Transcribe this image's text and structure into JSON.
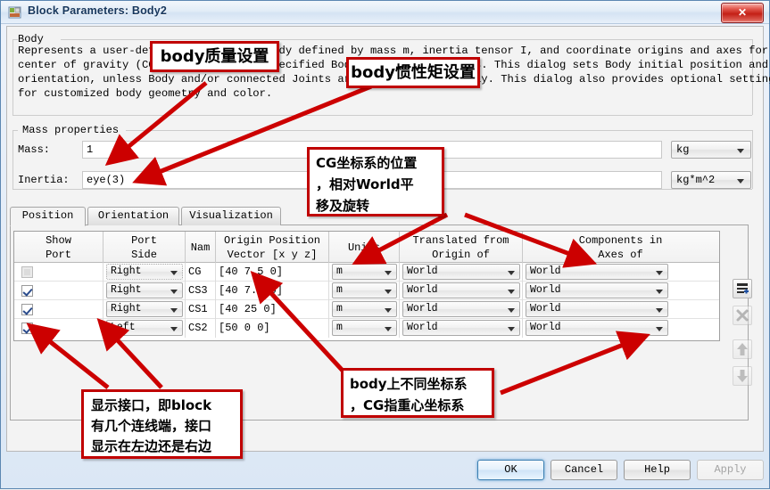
{
  "window": {
    "title": "Block Parameters: Body2",
    "icon": "block-parameters-icon",
    "close_label": "✕"
  },
  "description": {
    "heading": "Body",
    "lines": [
      "Represents a user-defined rigid body. Body defined by mass m, inertia tensor I, and coordinate origins and axes for",
      "center of gravity (CG) and other user-specified Body coordinate systems. This dialog sets Body initial position and",
      "orientation, unless Body and/or connected Joints are actuated separately. This dialog also provides optional settings",
      "for customized body geometry and color."
    ]
  },
  "mass_properties": {
    "group_title": "Mass properties",
    "mass": {
      "label": "Mass:",
      "value": "1",
      "unit": "kg"
    },
    "inertia": {
      "label": "Inertia:",
      "value": "eye(3)",
      "unit": "kg*m^2"
    }
  },
  "tabs": [
    {
      "label": "Position",
      "active": true
    },
    {
      "label": "Orientation",
      "active": false
    },
    {
      "label": "Visualization",
      "active": false
    }
  ],
  "table": {
    "headers": [
      "Show\nPort",
      "Port\nSide",
      "Nam",
      "Origin Position\nVector [x y z]",
      "Units",
      "Translated from\nOrigin of",
      "Components in\nAxes of"
    ],
    "rows": [
      {
        "show_port": false,
        "show_port_enabled": false,
        "port_side": "Right",
        "name": "CG",
        "origin_position": "[40 7.5 0]",
        "units": "m",
        "translated_from": "World",
        "components_in": "World"
      },
      {
        "show_port": true,
        "show_port_enabled": true,
        "port_side": "Right",
        "name": "CS3",
        "origin_position": "[40 7.5 0]",
        "units": "m",
        "translated_from": "World",
        "components_in": "World"
      },
      {
        "show_port": true,
        "show_port_enabled": true,
        "port_side": "Right",
        "name": "CS1",
        "origin_position": "[40 25 0]",
        "units": "m",
        "translated_from": "World",
        "components_in": "World"
      },
      {
        "show_port": true,
        "show_port_enabled": true,
        "port_side": "Left",
        "name": "CS2",
        "origin_position": "[50 0 0]",
        "units": "m",
        "translated_from": "World",
        "components_in": "World"
      }
    ],
    "side_tools": [
      {
        "name": "add-row-icon",
        "enabled": true
      },
      {
        "name": "delete-row-icon",
        "enabled": false
      },
      {
        "name": "move-up-icon",
        "enabled": false
      },
      {
        "name": "move-down-icon",
        "enabled": false
      }
    ]
  },
  "buttons": {
    "ok": "OK",
    "cancel": "Cancel",
    "help": "Help",
    "apply": "Apply",
    "apply_enabled": false
  },
  "annotations": [
    {
      "id": "mass-note",
      "text": [
        "body质量设置"
      ]
    },
    {
      "id": "inertia-note",
      "text": [
        "body惯性矩设置"
      ]
    },
    {
      "id": "cg-note",
      "text": [
        "CG坐标系的位置",
        "，相对World平",
        "移及旋转"
      ]
    },
    {
      "id": "coordsys-note",
      "text": [
        "body上不同坐标系",
        "，CG指重心坐标系"
      ]
    },
    {
      "id": "showport-note",
      "text": [
        "显示接口，即block",
        "有几个连线端，接口",
        "显示在左边还是右边"
      ]
    }
  ],
  "colors": {
    "annotation_border": "#c00000",
    "title_text": "#16365c",
    "close_button": "#c41f16"
  }
}
